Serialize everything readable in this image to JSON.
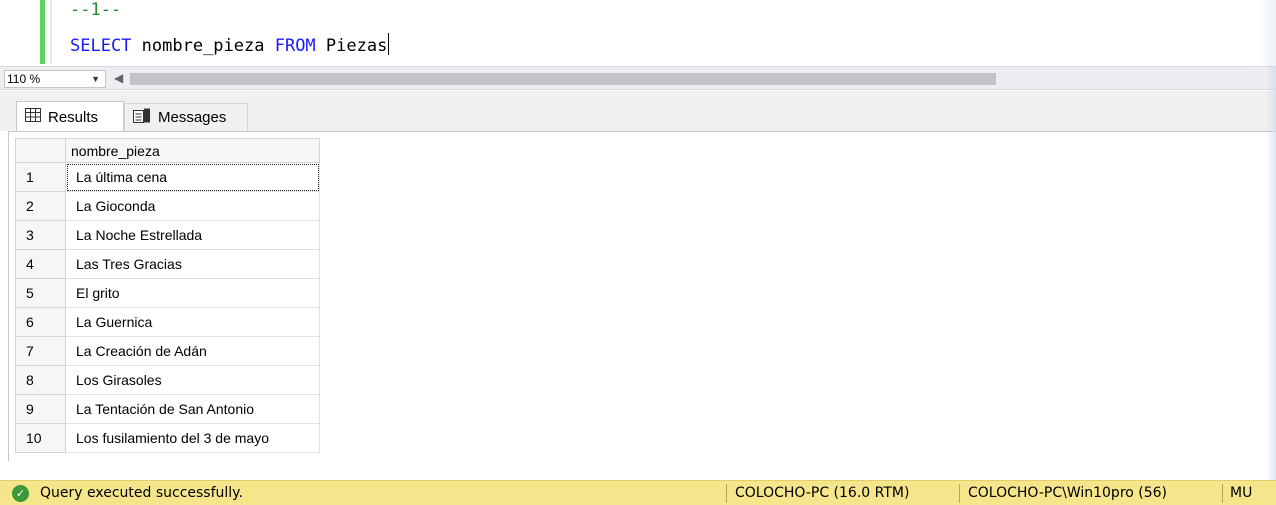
{
  "editor": {
    "line1": "--1--",
    "line2_kw1": "SELECT",
    "line2_mid": " nombre_pieza ",
    "line2_kw2": "FROM",
    "line2_end": " Piezas"
  },
  "zoom": {
    "value": "110 %"
  },
  "tabs": [
    {
      "label": "Results",
      "icon": "grid-icon"
    },
    {
      "label": "Messages",
      "icon": "messages-icon"
    }
  ],
  "grid": {
    "columns": [
      "nombre_pieza"
    ],
    "rows": [
      {
        "n": "1",
        "nombre_pieza": "La última cena"
      },
      {
        "n": "2",
        "nombre_pieza": "La Gioconda"
      },
      {
        "n": "3",
        "nombre_pieza": "La Noche Estrellada"
      },
      {
        "n": "4",
        "nombre_pieza": "Las Tres Gracias"
      },
      {
        "n": "5",
        "nombre_pieza": "El grito"
      },
      {
        "n": "6",
        "nombre_pieza": "La Guernica"
      },
      {
        "n": "7",
        "nombre_pieza": "La Creación de Adán"
      },
      {
        "n": "8",
        "nombre_pieza": "Los Girasoles"
      },
      {
        "n": "9",
        "nombre_pieza": "La Tentación de San Antonio"
      },
      {
        "n": "10",
        "nombre_pieza": "Los fusilamiento del 3 de mayo"
      }
    ]
  },
  "status": {
    "message": "Query executed successfully.",
    "server": "COLOCHO-PC (16.0 RTM)",
    "user": "COLOCHO-PC\\Win10pro (56)",
    "db": "MU",
    "color": "#f5e68c"
  }
}
